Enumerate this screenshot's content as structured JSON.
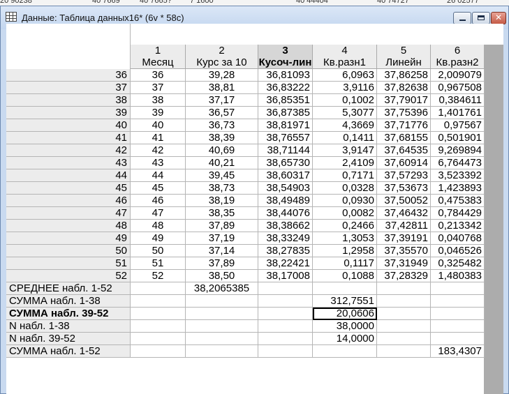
{
  "background_fragments": [
    "20 90238",
    "40 7669",
    "40 7665?",
    "7 1600",
    "40 44404",
    "40 74727",
    "26 02577"
  ],
  "window": {
    "title": "Данные: Таблица данных16* (6v * 58c)",
    "icon": "spreadsheet-icon",
    "controls": [
      "minimize-icon",
      "maximize-icon",
      "close-icon"
    ]
  },
  "columns": [
    {
      "num": "1",
      "name": "Месяц"
    },
    {
      "num": "2",
      "name": "Курс за 10"
    },
    {
      "num": "3",
      "name": "Кусоч-лин"
    },
    {
      "num": "4",
      "name": "Кв.разн1"
    },
    {
      "num": "5",
      "name": "Линейн"
    },
    {
      "num": "6",
      "name": "Кв.разн2"
    }
  ],
  "selected_column": "3",
  "rows": [
    {
      "label": "36",
      "cells": [
        "36",
        "39,28",
        "36,81093",
        "6,0963",
        "37,86258",
        "2,009079"
      ]
    },
    {
      "label": "37",
      "cells": [
        "37",
        "38,81",
        "36,83222",
        "3,9116",
        "37,82638",
        "0,967508"
      ]
    },
    {
      "label": "38",
      "cells": [
        "38",
        "37,17",
        "36,85351",
        "0,1002",
        "37,79017",
        "0,384611"
      ]
    },
    {
      "label": "39",
      "cells": [
        "39",
        "36,57",
        "36,87385",
        "5,3077",
        "37,75396",
        "1,401761"
      ]
    },
    {
      "label": "40",
      "cells": [
        "40",
        "36,73",
        "38,81971",
        "4,3669",
        "37,71776",
        "0,97567"
      ]
    },
    {
      "label": "41",
      "cells": [
        "41",
        "38,39",
        "38,76557",
        "0,1411",
        "37,68155",
        "0,501901"
      ]
    },
    {
      "label": "42",
      "cells": [
        "42",
        "40,69",
        "38,71144",
        "3,9147",
        "37,64535",
        "9,269894"
      ]
    },
    {
      "label": "43",
      "cells": [
        "43",
        "40,21",
        "38,65730",
        "2,4109",
        "37,60914",
        "6,764473"
      ]
    },
    {
      "label": "44",
      "cells": [
        "44",
        "39,45",
        "38,60317",
        "0,7171",
        "37,57293",
        "3,523392"
      ]
    },
    {
      "label": "45",
      "cells": [
        "45",
        "38,73",
        "38,54903",
        "0,0328",
        "37,53673",
        "1,423893"
      ]
    },
    {
      "label": "46",
      "cells": [
        "46",
        "38,19",
        "38,49489",
        "0,0930",
        "37,50052",
        "0,475383"
      ]
    },
    {
      "label": "47",
      "cells": [
        "47",
        "38,35",
        "38,44076",
        "0,0082",
        "37,46432",
        "0,784429"
      ]
    },
    {
      "label": "48",
      "cells": [
        "48",
        "37,89",
        "38,38662",
        "0,2466",
        "37,42811",
        "0,213342"
      ]
    },
    {
      "label": "49",
      "cells": [
        "49",
        "37,19",
        "38,33249",
        "1,3053",
        "37,39191",
        "0,040768"
      ]
    },
    {
      "label": "50",
      "cells": [
        "50",
        "37,14",
        "38,27835",
        "1,2958",
        "37,35570",
        "0,046526"
      ]
    },
    {
      "label": "51",
      "cells": [
        "51",
        "37,89",
        "38,22421",
        "0,1117",
        "37,31949",
        "0,325482"
      ]
    },
    {
      "label": "52",
      "cells": [
        "52",
        "38,50",
        "38,17008",
        "0,1088",
        "37,28329",
        "1,480383"
      ]
    }
  ],
  "summary_rows": [
    {
      "label": "СРЕДНЕЕ набл. 1-52",
      "bold": false,
      "cells": [
        "",
        "38,2065385",
        "",
        "",
        "",
        ""
      ]
    },
    {
      "label": "СУММА набл. 1-38",
      "bold": false,
      "cells": [
        "",
        "",
        "",
        "312,7551",
        "",
        ""
      ]
    },
    {
      "label": "СУММА набл. 39-52",
      "bold": true,
      "cells": [
        "",
        "",
        "",
        "20,0606",
        "",
        ""
      ],
      "focused_col": 3
    },
    {
      "label": "N набл. 1-38",
      "bold": false,
      "cells": [
        "",
        "",
        "",
        "38,0000",
        "",
        ""
      ]
    },
    {
      "label": "N набл. 39-52",
      "bold": false,
      "cells": [
        "",
        "",
        "",
        "14,0000",
        "",
        ""
      ]
    },
    {
      "label": "СУММА набл. 1-52",
      "bold": false,
      "cells": [
        "",
        "",
        "",
        "",
        "",
        "183,4307"
      ]
    }
  ]
}
